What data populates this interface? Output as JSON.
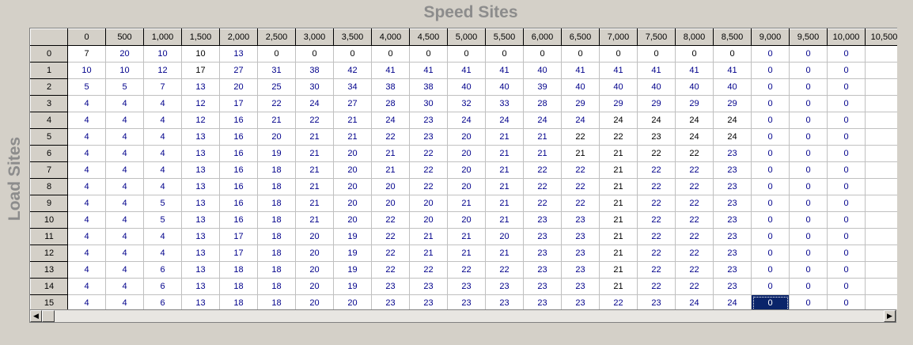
{
  "titles": {
    "x_axis": "Speed Sites",
    "y_axis": "Load Sites"
  },
  "columns": [
    "0",
    "500",
    "1,000",
    "1,500",
    "2,000",
    "2,500",
    "3,000",
    "3,500",
    "4,000",
    "4,500",
    "5,000",
    "5,500",
    "6,000",
    "6,500",
    "7,000",
    "7,500",
    "8,000",
    "8,500",
    "9,000",
    "9,500",
    "10,000",
    "10,500"
  ],
  "rows": [
    {
      "label": "0",
      "cells": [
        "7",
        "20",
        "10",
        "10",
        "13",
        "0",
        "0",
        "0",
        "0",
        "0",
        "0",
        "0",
        "0",
        "0",
        "0",
        "0",
        "0",
        "0",
        "0",
        "0",
        "0",
        ""
      ]
    },
    {
      "label": "1",
      "cells": [
        "10",
        "10",
        "12",
        "17",
        "27",
        "31",
        "38",
        "42",
        "41",
        "41",
        "41",
        "41",
        "40",
        "41",
        "41",
        "41",
        "41",
        "41",
        "0",
        "0",
        "0",
        ""
      ]
    },
    {
      "label": "2",
      "cells": [
        "5",
        "5",
        "7",
        "13",
        "20",
        "25",
        "30",
        "34",
        "38",
        "38",
        "40",
        "40",
        "39",
        "40",
        "40",
        "40",
        "40",
        "40",
        "0",
        "0",
        "0",
        ""
      ]
    },
    {
      "label": "3",
      "cells": [
        "4",
        "4",
        "4",
        "12",
        "17",
        "22",
        "24",
        "27",
        "28",
        "30",
        "32",
        "33",
        "28",
        "29",
        "29",
        "29",
        "29",
        "29",
        "0",
        "0",
        "0",
        ""
      ]
    },
    {
      "label": "4",
      "cells": [
        "4",
        "4",
        "4",
        "12",
        "16",
        "21",
        "22",
        "21",
        "24",
        "23",
        "24",
        "24",
        "24",
        "24",
        "24",
        "24",
        "24",
        "24",
        "0",
        "0",
        "0",
        ""
      ]
    },
    {
      "label": "5",
      "cells": [
        "4",
        "4",
        "4",
        "13",
        "16",
        "20",
        "21",
        "21",
        "22",
        "23",
        "20",
        "21",
        "21",
        "22",
        "22",
        "23",
        "24",
        "24",
        "0",
        "0",
        "0",
        ""
      ]
    },
    {
      "label": "6",
      "cells": [
        "4",
        "4",
        "4",
        "13",
        "16",
        "19",
        "21",
        "20",
        "21",
        "22",
        "20",
        "21",
        "21",
        "21",
        "21",
        "22",
        "22",
        "23",
        "0",
        "0",
        "0",
        ""
      ]
    },
    {
      "label": "7",
      "cells": [
        "4",
        "4",
        "4",
        "13",
        "16",
        "18",
        "21",
        "20",
        "21",
        "22",
        "20",
        "21",
        "22",
        "22",
        "21",
        "22",
        "22",
        "23",
        "0",
        "0",
        "0",
        ""
      ]
    },
    {
      "label": "8",
      "cells": [
        "4",
        "4",
        "4",
        "13",
        "16",
        "18",
        "21",
        "20",
        "20",
        "22",
        "20",
        "21",
        "22",
        "22",
        "21",
        "22",
        "22",
        "23",
        "0",
        "0",
        "0",
        ""
      ]
    },
    {
      "label": "9",
      "cells": [
        "4",
        "4",
        "5",
        "13",
        "16",
        "18",
        "21",
        "20",
        "20",
        "20",
        "21",
        "21",
        "22",
        "22",
        "21",
        "22",
        "22",
        "23",
        "0",
        "0",
        "0",
        ""
      ]
    },
    {
      "label": "10",
      "cells": [
        "4",
        "4",
        "5",
        "13",
        "16",
        "18",
        "21",
        "20",
        "22",
        "20",
        "20",
        "21",
        "23",
        "23",
        "21",
        "22",
        "22",
        "23",
        "0",
        "0",
        "0",
        ""
      ]
    },
    {
      "label": "11",
      "cells": [
        "4",
        "4",
        "4",
        "13",
        "17",
        "18",
        "20",
        "19",
        "22",
        "21",
        "21",
        "20",
        "23",
        "23",
        "21",
        "22",
        "22",
        "23",
        "0",
        "0",
        "0",
        ""
      ]
    },
    {
      "label": "12",
      "cells": [
        "4",
        "4",
        "4",
        "13",
        "17",
        "18",
        "20",
        "19",
        "22",
        "21",
        "21",
        "21",
        "23",
        "23",
        "21",
        "22",
        "22",
        "23",
        "0",
        "0",
        "0",
        ""
      ]
    },
    {
      "label": "13",
      "cells": [
        "4",
        "4",
        "6",
        "13",
        "18",
        "18",
        "20",
        "19",
        "22",
        "22",
        "22",
        "22",
        "23",
        "23",
        "21",
        "22",
        "22",
        "23",
        "0",
        "0",
        "0",
        ""
      ]
    },
    {
      "label": "14",
      "cells": [
        "4",
        "4",
        "6",
        "13",
        "18",
        "18",
        "20",
        "19",
        "23",
        "23",
        "23",
        "23",
        "23",
        "23",
        "21",
        "22",
        "22",
        "23",
        "0",
        "0",
        "0",
        ""
      ]
    },
    {
      "label": "15",
      "cells": [
        "4",
        "4",
        "6",
        "13",
        "18",
        "18",
        "20",
        "20",
        "23",
        "23",
        "23",
        "23",
        "23",
        "23",
        "22",
        "23",
        "24",
        "24",
        "0",
        "0",
        "0",
        ""
      ]
    }
  ],
  "black_cells": [
    [
      0,
      0
    ],
    [
      0,
      3
    ],
    [
      0,
      5
    ],
    [
      0,
      6
    ],
    [
      0,
      7
    ],
    [
      0,
      8
    ],
    [
      0,
      9
    ],
    [
      0,
      10
    ],
    [
      0,
      11
    ],
    [
      0,
      12
    ],
    [
      0,
      13
    ],
    [
      0,
      14
    ],
    [
      0,
      15
    ],
    [
      0,
      16
    ],
    [
      0,
      17
    ],
    [
      1,
      3
    ],
    [
      4,
      14
    ],
    [
      4,
      15
    ],
    [
      4,
      16
    ],
    [
      4,
      17
    ],
    [
      5,
      13
    ],
    [
      5,
      14
    ],
    [
      5,
      15
    ],
    [
      5,
      16
    ],
    [
      5,
      17
    ],
    [
      6,
      13
    ],
    [
      6,
      14
    ],
    [
      6,
      15
    ],
    [
      6,
      16
    ],
    [
      7,
      14
    ],
    [
      8,
      14
    ],
    [
      9,
      14
    ],
    [
      10,
      14
    ],
    [
      11,
      14
    ],
    [
      12,
      14
    ],
    [
      13,
      14
    ],
    [
      14,
      14
    ]
  ],
  "selected_cell": {
    "row": 15,
    "col": 18
  },
  "scrollbar": {
    "left_arrow": "◀",
    "right_arrow": "▶"
  }
}
